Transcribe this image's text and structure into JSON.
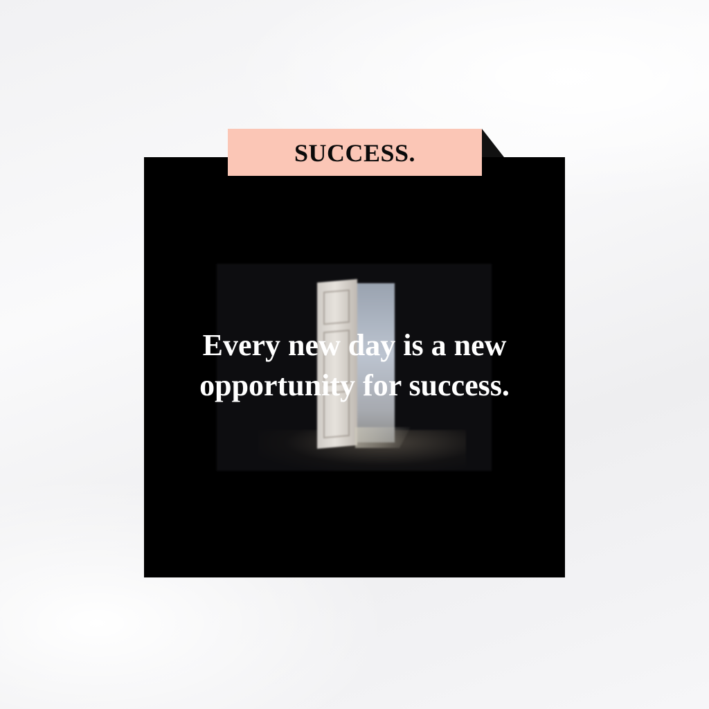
{
  "tag": {
    "label": "SUCCESS."
  },
  "quote": {
    "text": "Every new day is a new\nopportunity for success."
  },
  "colors": {
    "background": "#f4f4f6",
    "card": "#000000",
    "tag": "#fbc6b6",
    "quote_text": "#ffffff"
  },
  "image": {
    "subject": "open-door-photo"
  }
}
